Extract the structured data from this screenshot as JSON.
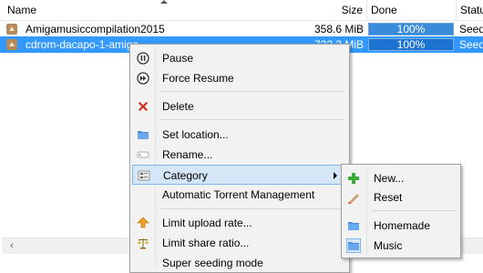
{
  "table": {
    "columns": {
      "name": "Name",
      "size": "Size",
      "done": "Done",
      "status": "Status"
    },
    "rows": [
      {
        "name": "Amigamusiccompilation2015",
        "size": "358.6 MiB",
        "done": "100%",
        "status": "Seeding",
        "selected": false
      },
      {
        "name": "cdrom-dacapo-1-amiga",
        "size": "722.3 MiB",
        "done": "100%",
        "status": "Seeding",
        "selected": true
      }
    ]
  },
  "context_menu": {
    "items": [
      {
        "label": "Pause",
        "icon": "pause-icon"
      },
      {
        "label": "Force Resume",
        "icon": "force-resume-icon"
      },
      {
        "label": "Delete",
        "icon": "delete-icon"
      },
      {
        "label": "Set location...",
        "icon": "folder-icon"
      },
      {
        "label": "Rename...",
        "icon": "rename-icon"
      },
      {
        "label": "Category",
        "icon": "category-icon",
        "highlighted": true,
        "has_submenu": true
      },
      {
        "label": "Automatic Torrent Management",
        "icon": ""
      },
      {
        "label": "Limit upload rate...",
        "icon": "upload-limit-icon"
      },
      {
        "label": "Limit share ratio...",
        "icon": "ratio-limit-icon"
      },
      {
        "label": "Super seeding mode",
        "icon": ""
      }
    ]
  },
  "category_submenu": {
    "items": [
      {
        "label": "New...",
        "icon": "add-icon"
      },
      {
        "label": "Reset",
        "icon": "reset-icon"
      },
      {
        "label": "Homemade",
        "icon": "folder-icon"
      },
      {
        "label": "Music",
        "icon": "folder-icon",
        "selected": true
      }
    ]
  },
  "colors": {
    "selection": "#3399ff",
    "menu_highlight": "#d5e6f7",
    "progress": "#3a8bd8"
  }
}
